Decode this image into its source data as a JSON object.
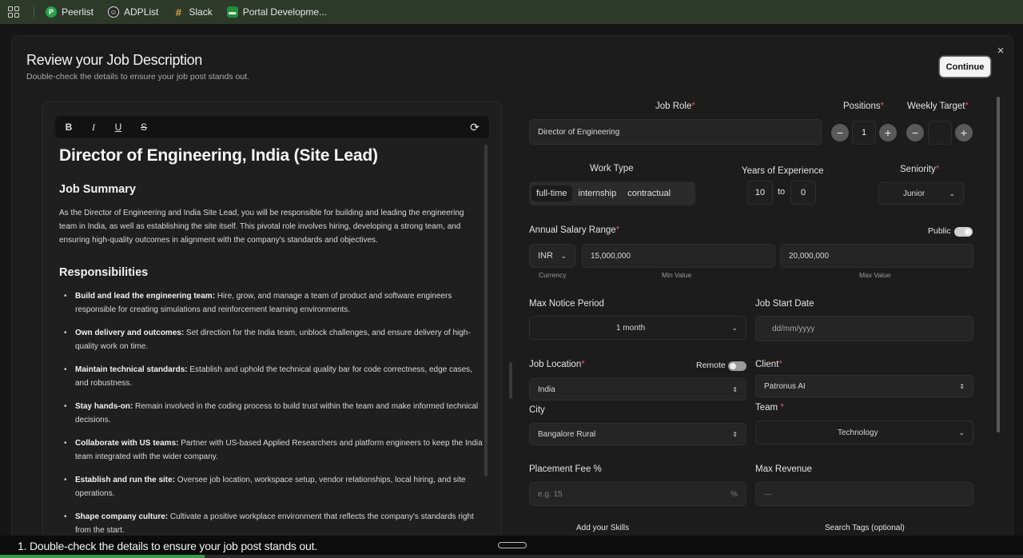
{
  "bookmarks": [
    {
      "label": "Peerlist",
      "icon": "peerlist-icon",
      "color": "#2aa14b",
      "glyph": "P"
    },
    {
      "label": "ADPList",
      "icon": "adplist-icon",
      "color": "#3a3a3a",
      "glyph": "☺"
    },
    {
      "label": "Slack",
      "icon": "slack-icon",
      "color": "#4a154b",
      "glyph": "#"
    },
    {
      "label": "Portal Developme...",
      "icon": "portal-icon",
      "color": "#1f8f3a",
      "glyph": "▬"
    }
  ],
  "modal": {
    "title": "Review your Job Description",
    "subtitle": "Double-check the details to ensure your job post stands out.",
    "continue_label": "Continue",
    "close_glyph": "×"
  },
  "editor": {
    "toolbar": {
      "bold": "B",
      "italic": "I",
      "underline": "U",
      "strike": "S",
      "regenerate": "⟳"
    },
    "title": "Director of Engineering, India (Site Lead)",
    "summary_heading": "Job Summary",
    "summary_text": "As the Director of Engineering and India Site Lead, you will be responsible for building and leading the engineering team in India, as well as establishing the site itself. This pivotal role involves hiring, developing a strong team, and ensuring high-quality outcomes in alignment with the company's standards and objectives.",
    "responsibilities_heading": "Responsibilities",
    "responsibilities": [
      {
        "title": "Build and lead the engineering team:",
        "text": " Hire, grow, and manage a team of product and software engineers responsible for creating simulations and reinforcement learning environments."
      },
      {
        "title": "Own delivery and outcomes:",
        "text": " Set direction for the India team, unblock challenges, and ensure delivery of high-quality work on time."
      },
      {
        "title": "Maintain technical standards:",
        "text": " Establish and uphold the technical quality bar for code correctness, edge cases, and robustness."
      },
      {
        "title": "Stay hands-on:",
        "text": " Remain involved in the coding process to build trust within the team and make informed technical decisions."
      },
      {
        "title": "Collaborate with US teams:",
        "text": " Partner with US-based Applied Researchers and platform engineers to keep the India team integrated with the wider company."
      },
      {
        "title": "Establish and run the site:",
        "text": " Oversee job location, workspace setup, vendor relationships, local hiring, and site operations."
      },
      {
        "title": "Shape company culture:",
        "text": " Cultivate a positive workplace environment that reflects the company's standards right from the start."
      }
    ]
  },
  "form": {
    "job_role": {
      "label": "Job Role",
      "value": "Director of Engineering"
    },
    "positions": {
      "label": "Positions",
      "value": "1"
    },
    "weekly_target": {
      "label": "Weekly Target",
      "value": ""
    },
    "work_type": {
      "label": "Work Type",
      "options": [
        "full-time",
        "internship",
        "contractual"
      ],
      "selected": "full-time"
    },
    "experience": {
      "label": "Years of Experience",
      "min": "10",
      "to": "to",
      "max": "0"
    },
    "seniority": {
      "label": "Seniority",
      "value": "Junior"
    },
    "salary": {
      "label": "Annual Salary Range",
      "public_label": "Public",
      "currency": "INR",
      "min": "15,000,000",
      "max": "20,000,000",
      "currency_hint": "Currency",
      "min_hint": "Min Value",
      "max_hint": "Max Value"
    },
    "notice": {
      "label": "Max Notice Period",
      "value": "1 month"
    },
    "start_date": {
      "label": "Job Start Date",
      "placeholder": "dd/mm/yyyy"
    },
    "location": {
      "label": "Job Location",
      "remote_label": "Remote",
      "value": "India"
    },
    "client": {
      "label": "Client",
      "value": "Patronus AI"
    },
    "city": {
      "label": "City",
      "value": "Bangalore Rural"
    },
    "team": {
      "label": "Team",
      "value": "Technology"
    },
    "placement_fee": {
      "label": "Placement Fee %",
      "placeholder": "e.g. 15",
      "unit": "%"
    },
    "max_revenue": {
      "label": "Max Revenue",
      "placeholder": "—"
    },
    "skills_label": "Add your Skills",
    "tags_label": "Search Tags (optional)",
    "required_mark": "*"
  },
  "caption": {
    "text": "1. Double-check the details to ensure your job post stands out.",
    "progress": 0.2
  }
}
